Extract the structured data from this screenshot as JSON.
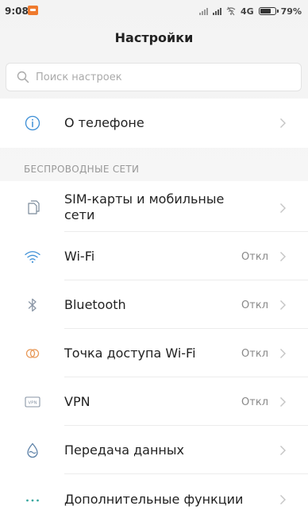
{
  "status_bar": {
    "time": "9:08",
    "network": "4G",
    "battery_percent": "79%",
    "battery_level": 0.79,
    "app_notification_icon": "notification-app-icon",
    "icons": [
      "signal-icon",
      "signal-icon",
      "wifi-off-icon",
      "battery-icon"
    ]
  },
  "header": {
    "title": "Настройки"
  },
  "search": {
    "placeholder": "Поиск настроек",
    "icon": "search-icon"
  },
  "about": {
    "label": "О телефоне",
    "icon": "info-icon"
  },
  "wireless": {
    "section_title": "БЕСПРОВОДНЫЕ СЕТИ",
    "items": [
      {
        "id": "sim",
        "label": "SIM-карты и мобильные сети",
        "label_line1": "SIM-карты и мобильные",
        "label_line2": "сети",
        "value": "",
        "icon": "sim-cards-icon"
      },
      {
        "id": "wifi",
        "label": "Wi-Fi",
        "value": "Откл",
        "icon": "wifi-icon"
      },
      {
        "id": "bluetooth",
        "label": "Bluetooth",
        "value": "Откл",
        "icon": "bluetooth-icon"
      },
      {
        "id": "hotspot",
        "label": "Точка доступа Wi-Fi",
        "value": "Откл",
        "icon": "hotspot-icon"
      },
      {
        "id": "vpn",
        "label": "VPN",
        "value": "Откл",
        "icon": "vpn-icon"
      },
      {
        "id": "data",
        "label": "Передача данных",
        "value": "",
        "icon": "data-usage-icon"
      },
      {
        "id": "more",
        "label": "Дополнительные функции",
        "value": "",
        "icon": "more-icon"
      }
    ]
  },
  "colors": {
    "accent_blue": "#3d8fd6",
    "hotspot_orange": "#e89a5a",
    "text_primary": "#222222",
    "text_secondary": "#888888",
    "section_title": "#999999",
    "background": "#f4f4f4",
    "status_app_icon": "#ef7a2e"
  }
}
